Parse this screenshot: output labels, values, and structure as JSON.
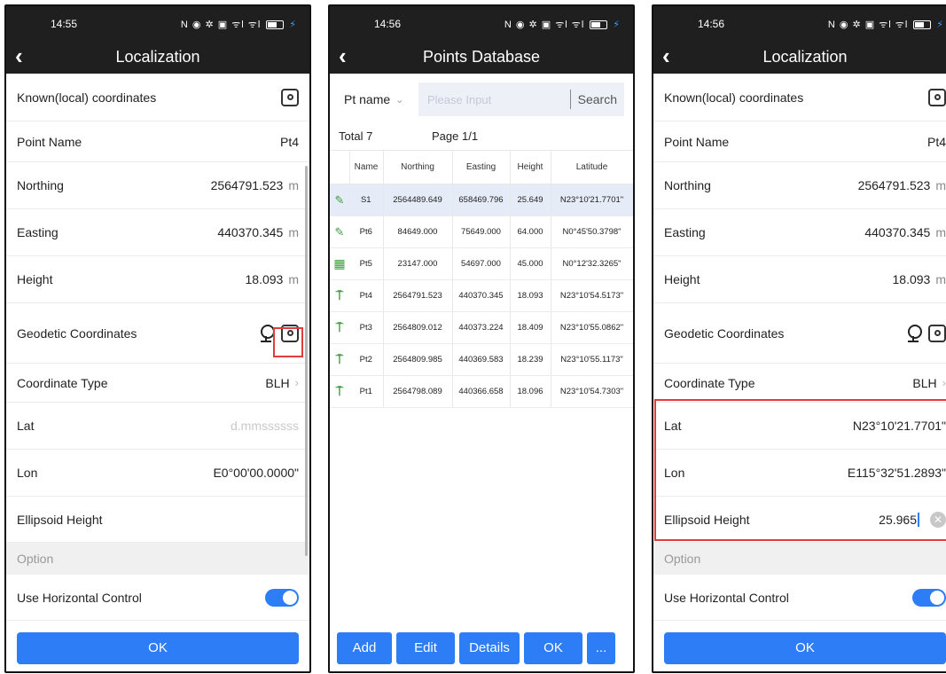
{
  "status": {
    "p1_time": "14:55",
    "p2_time": "14:56",
    "p3_time": "14:56",
    "icons": "N ◉ ✲ ▣ ᯤl ᯤl"
  },
  "localization_before": {
    "title": "Localization",
    "known_label": "Known(local) coordinates",
    "point_name_label": "Point Name",
    "point_name_value": "Pt4",
    "northing_label": "Northing",
    "northing_value": "2564791.523",
    "easting_label": "Easting",
    "easting_value": "440370.345",
    "height_label": "Height",
    "height_value": "18.093",
    "unit": "m",
    "geodetic_label": "Geodetic Coordinates",
    "coord_type_label": "Coordinate Type",
    "coord_type_value": "BLH",
    "lat_label": "Lat",
    "lat_placeholder": "d.mmssssss",
    "lon_label": "Lon",
    "lon_value": "E0°00'00.0000\"",
    "ell_label": "Ellipsoid Height",
    "option_label": "Option",
    "horiz_label": "Use Horizontal Control",
    "ok_label": "OK"
  },
  "points_db": {
    "title": "Points Database",
    "select_label": "Pt name",
    "search_placeholder": "Please Input",
    "search_button": "Search",
    "total": "Total 7",
    "page": "Page 1/1",
    "headers": [
      "Name",
      "Northing",
      "Easting",
      "Height",
      "Latitude"
    ],
    "rows": [
      {
        "icon": "pen",
        "name": "S1",
        "northing": "2564489.649",
        "easting": "658469.796",
        "height": "25.649",
        "lat": "N23°10'21.7701\""
      },
      {
        "icon": "pen",
        "name": "Pt6",
        "northing": "84649.000",
        "easting": "75649.000",
        "height": "64.000",
        "lat": "N0°45'50.3798\""
      },
      {
        "icon": "calc",
        "name": "Pt5",
        "northing": "23147.000",
        "easting": "54697.000",
        "height": "45.000",
        "lat": "N0°12'32.3265\""
      },
      {
        "icon": "antenna",
        "name": "Pt4",
        "northing": "2564791.523",
        "easting": "440370.345",
        "height": "18.093",
        "lat": "N23°10'54.5173\""
      },
      {
        "icon": "antenna",
        "name": "Pt3",
        "northing": "2564809.012",
        "easting": "440373.224",
        "height": "18.409",
        "lat": "N23°10'55.0862\""
      },
      {
        "icon": "antenna",
        "name": "Pt2",
        "northing": "2564809.985",
        "easting": "440369.583",
        "height": "18.239",
        "lat": "N23°10'55.1173\""
      },
      {
        "icon": "antenna",
        "name": "Pt1",
        "northing": "2564798.089",
        "easting": "440366.658",
        "height": "18.096",
        "lat": "N23°10'54.7303\""
      }
    ],
    "btn_add": "Add",
    "btn_edit": "Edit",
    "btn_details": "Details",
    "btn_ok": "OK",
    "btn_more": "..."
  },
  "localization_after": {
    "lat_value": "N23°10'21.7701\"",
    "lon_value": "E115°32'51.2893\"",
    "ell_value": "25.965"
  },
  "colors": {
    "accent": "#2d7df6",
    "highlight": "#e03c3c",
    "topbar": "#1f1f1f",
    "icon_green": "#3c9b3c"
  }
}
